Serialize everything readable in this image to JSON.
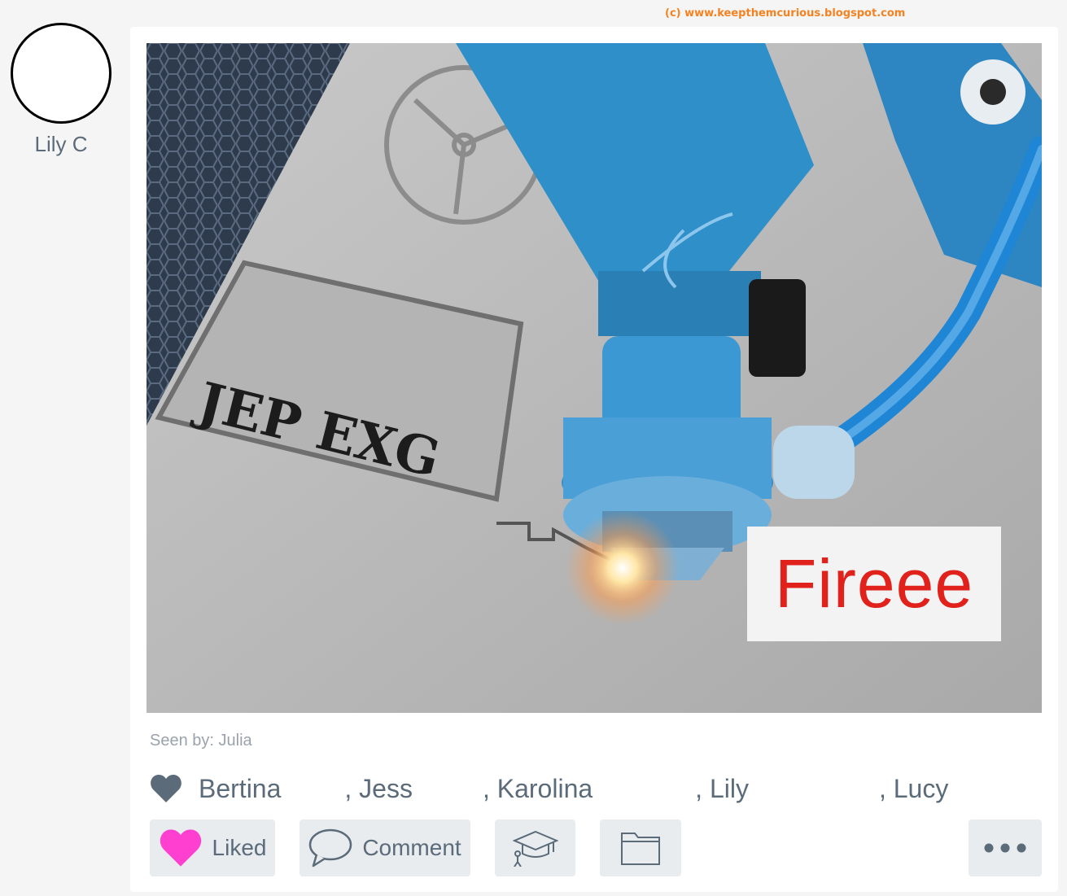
{
  "watermark": "(c) www.keepthemcurious.blogspot.com",
  "post": {
    "author": {
      "name": "Lily C"
    },
    "photo": {
      "caption": "Fireee"
    },
    "seen_by": "Seen by: Julia",
    "likes": {
      "names": [
        "Bertina",
        "Jess",
        "Karolina",
        "Lily",
        "Lucy"
      ]
    },
    "actions": {
      "liked_label": "Liked",
      "comment_label": "Comment"
    }
  },
  "colors": {
    "liked_heart": "#ff3fcf",
    "likes_heart": "#5b6b7a",
    "caption_text": "#e0211c",
    "button_bg": "#e9ecef"
  },
  "icons": [
    "heart-icon",
    "comment-icon",
    "graduation-cap-icon",
    "folder-icon",
    "more-options-icon"
  ]
}
